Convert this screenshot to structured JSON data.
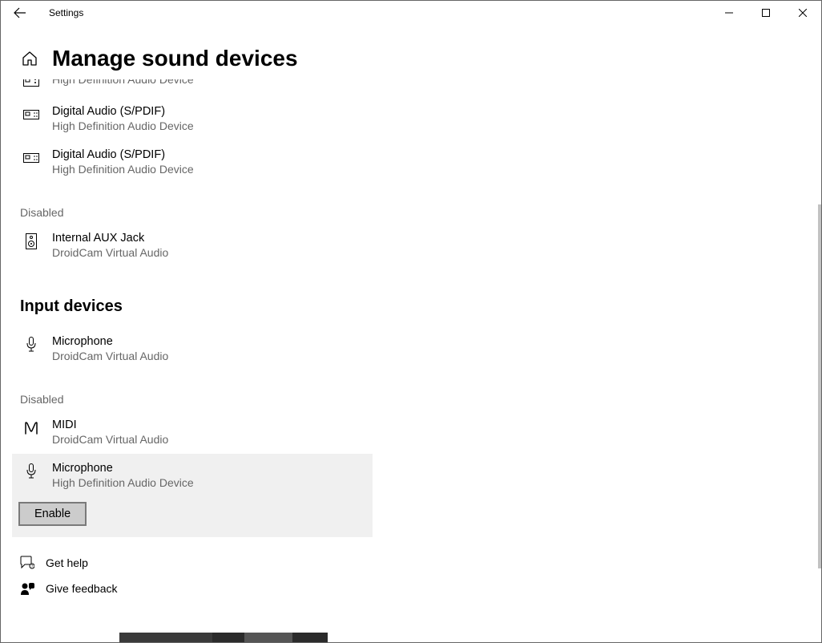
{
  "window": {
    "title": "Settings"
  },
  "page": {
    "title": "Manage sound devices"
  },
  "output_devices": {
    "cutoff": {
      "sub": "High Definition Audio Device"
    },
    "items": [
      {
        "name": "Digital Audio (S/PDIF)",
        "sub": "High Definition Audio Device",
        "icon": "soundcard"
      },
      {
        "name": "Digital Audio (S/PDIF)",
        "sub": "High Definition Audio Device",
        "icon": "soundcard"
      }
    ],
    "disabled_label": "Disabled",
    "disabled_items": [
      {
        "name": "Internal AUX Jack",
        "sub": "DroidCam Virtual Audio",
        "icon": "speaker"
      }
    ]
  },
  "input_devices": {
    "header": "Input devices",
    "items": [
      {
        "name": "Microphone",
        "sub": "DroidCam Virtual Audio",
        "icon": "mic"
      }
    ],
    "disabled_label": "Disabled",
    "disabled_items": [
      {
        "name": "MIDI",
        "sub": "DroidCam Virtual Audio",
        "icon": "midi"
      }
    ],
    "selected": {
      "name": "Microphone",
      "sub": "High Definition Audio Device",
      "icon": "mic",
      "button_label": "Enable"
    }
  },
  "footer": {
    "help": "Get help",
    "feedback": "Give feedback"
  }
}
